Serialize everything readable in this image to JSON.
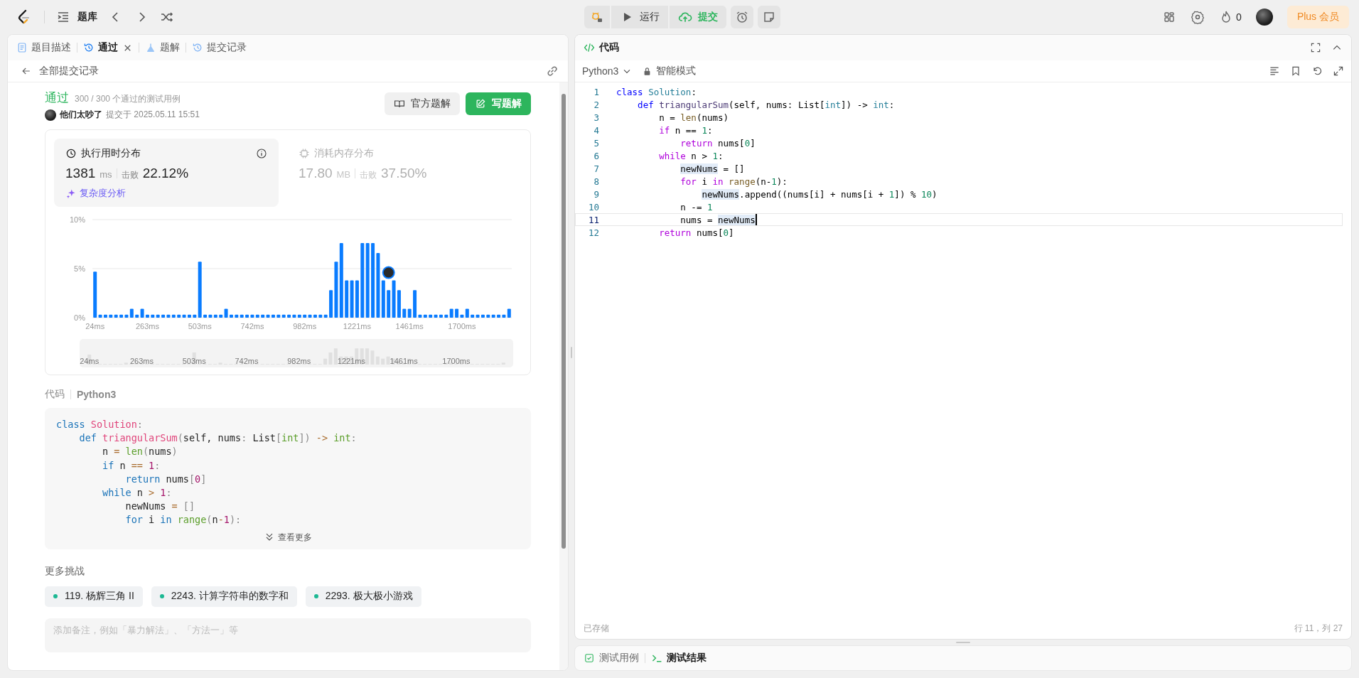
{
  "top_bar": {
    "nav_label": "题库",
    "run_button": "运行",
    "submit_button": "提交",
    "streak_count": "0",
    "plus_button": "Plus 会员"
  },
  "left_panel": {
    "tabs": [
      {
        "label": "题目描述",
        "selected": false,
        "closable": false
      },
      {
        "label": "通过",
        "selected": true,
        "closable": true
      },
      {
        "label": "题解",
        "selected": false,
        "closable": false
      },
      {
        "label": "提交记录",
        "selected": false,
        "closable": false
      }
    ],
    "back_link": "全部提交记录",
    "result": {
      "status": "通过",
      "cases": "300 / 300 个通过的测试用例",
      "user": "他们太吵了",
      "submitted": "提交于 2025.05.11 15:51"
    },
    "buttons": [
      {
        "label": "官方题解",
        "kind": "secondary"
      },
      {
        "label": "写题解",
        "kind": "primary"
      }
    ],
    "metrics": [
      {
        "title": "执行用时分布",
        "value": "1381",
        "unit": "ms",
        "beats_label": "击败",
        "beats": "22.12%",
        "selected": true,
        "link": "复杂度分析"
      },
      {
        "title": "消耗内存分布",
        "value": "17.80",
        "unit": "MB",
        "beats_label": "击败",
        "beats": "37.50%",
        "selected": false
      }
    ],
    "chart_data": {
      "type": "bar",
      "ylim": [
        0,
        10
      ],
      "yticks": [
        {
          "value": 0,
          "label": "0%"
        },
        {
          "value": 5,
          "label": "5%"
        },
        {
          "value": 10,
          "label": "10%"
        }
      ],
      "categories": [
        "24ms",
        null,
        null,
        null,
        null,
        null,
        null,
        null,
        null,
        null,
        "263ms",
        null,
        null,
        null,
        null,
        null,
        null,
        null,
        null,
        null,
        "503ms",
        null,
        null,
        null,
        null,
        null,
        null,
        null,
        null,
        null,
        "742ms",
        null,
        null,
        null,
        null,
        null,
        null,
        null,
        null,
        null,
        "982ms",
        null,
        null,
        null,
        null,
        null,
        null,
        null,
        null,
        null,
        "1221ms",
        null,
        null,
        null,
        null,
        null,
        null,
        null,
        null,
        null,
        "1461ms",
        null,
        null,
        null,
        null,
        null,
        null,
        null,
        null,
        null,
        "1700ms",
        null,
        null,
        null,
        null,
        null,
        null,
        null,
        null,
        null
      ],
      "series": [
        {
          "color": "#0a7cff",
          "values": [
            4.7,
            0.3,
            0.3,
            0.3,
            0.3,
            0.3,
            0.3,
            0.9,
            0.3,
            0.9,
            0.3,
            0.3,
            0.3,
            0.3,
            0.3,
            0.3,
            0.3,
            0.3,
            0.3,
            0.3,
            5.7,
            0.3,
            0.3,
            0.3,
            0.3,
            0.9,
            0.3,
            0.3,
            0.3,
            0.3,
            0.3,
            0.3,
            0.3,
            0.3,
            0.3,
            0.3,
            0.3,
            0.3,
            0.3,
            0.3,
            0.3,
            0.3,
            0.3,
            0.3,
            0.3,
            2.8,
            5.7,
            7.6,
            3.8,
            3.8,
            3.8,
            7.6,
            7.6,
            7.6,
            6.6,
            3.8,
            2.8,
            3.8,
            2.8,
            0.9,
            0.9,
            2.8,
            0.3,
            0.3,
            0.3,
            0.3,
            0.3,
            0.3,
            0.9,
            0.9,
            0.3,
            0.9,
            0.3,
            0.3,
            0.3,
            0.3,
            0.3,
            0.3,
            0.3,
            0.9
          ]
        }
      ]
    },
    "overview": {
      "tick_labels": [
        "24ms",
        "263ms",
        "503ms",
        "742ms",
        "982ms",
        "1221ms",
        "1461ms",
        "1700ms"
      ]
    },
    "code_label": "代码",
    "language": "Python3",
    "code": [
      {
        "tokens": [
          {
            "text": "class",
            "kind": "decl"
          },
          {
            "text": " Solution",
            "kind": "cls"
          },
          {
            "text": ":",
            "kind": "punct"
          }
        ]
      },
      {
        "tokens": [
          {
            "text": "    def",
            "kind": "decl"
          },
          {
            "text": " triangularSum",
            "kind": "fn"
          },
          {
            "text": "(",
            "kind": "punct"
          },
          {
            "text": "self, nums",
            "kind": "plain"
          },
          {
            "text": ":",
            "kind": "punct"
          },
          {
            "text": " List",
            "kind": "plain"
          },
          {
            "text": "[",
            "kind": "punct"
          },
          {
            "text": "int",
            "kind": "type"
          },
          {
            "text": "])",
            "kind": "punct"
          },
          {
            "text": " ->",
            "kind": "op"
          },
          {
            "text": " int",
            "kind": "type"
          },
          {
            "text": ":",
            "kind": "punct"
          }
        ]
      },
      {
        "tokens": [
          {
            "text": "        n",
            "kind": "plain"
          },
          {
            "text": " =",
            "kind": "op"
          },
          {
            "text": " len",
            "kind": "builtin"
          },
          {
            "text": "(",
            "kind": "punct"
          },
          {
            "text": "nums",
            "kind": "plain"
          },
          {
            "text": ")",
            "kind": "punct"
          }
        ]
      },
      {
        "tokens": [
          {
            "text": "        if",
            "kind": "decl"
          },
          {
            "text": " n",
            "kind": "plain"
          },
          {
            "text": " ==",
            "kind": "op"
          },
          {
            "text": " 1",
            "kind": "num"
          },
          {
            "text": ":",
            "kind": "punct"
          }
        ]
      },
      {
        "tokens": [
          {
            "text": "            return",
            "kind": "decl"
          },
          {
            "text": " nums",
            "kind": "plain"
          },
          {
            "text": "[",
            "kind": "punct"
          },
          {
            "text": "0",
            "kind": "num"
          },
          {
            "text": "]",
            "kind": "punct"
          }
        ]
      },
      {
        "tokens": [
          {
            "text": "        while",
            "kind": "decl"
          },
          {
            "text": " n",
            "kind": "plain"
          },
          {
            "text": " >",
            "kind": "op"
          },
          {
            "text": " 1",
            "kind": "num"
          },
          {
            "text": ":",
            "kind": "punct"
          }
        ]
      },
      {
        "tokens": [
          {
            "text": "            newNums",
            "kind": "plain"
          },
          {
            "text": " =",
            "kind": "op"
          },
          {
            "text": " []",
            "kind": "punct"
          }
        ]
      },
      {
        "tokens": [
          {
            "text": "            for",
            "kind": "decl"
          },
          {
            "text": " i",
            "kind": "plain"
          },
          {
            "text": " in",
            "kind": "decl"
          },
          {
            "text": " range",
            "kind": "builtin"
          },
          {
            "text": "(",
            "kind": "punct"
          },
          {
            "text": "n",
            "kind": "plain"
          },
          {
            "text": "-",
            "kind": "op"
          },
          {
            "text": "1",
            "kind": "num"
          },
          {
            "text": "):",
            "kind": "punct"
          }
        ]
      }
    ],
    "more_button": "查看更多",
    "more_title": "更多挑战",
    "challenges": [
      {
        "label": "119. 杨辉三角 II",
        "color": "#1cb893"
      },
      {
        "label": "2243. 计算字符串的数字和",
        "color": "#1cb893"
      },
      {
        "label": "2293. 极大极小游戏",
        "color": "#1cb893"
      }
    ],
    "note": {
      "placeholder": "添加备注，例如「暴力解法」、「方法一」等"
    }
  },
  "editor": {
    "title": "代码",
    "language": "Python3",
    "mode": "智能模式",
    "lines": [
      {
        "number": "1",
        "current": false,
        "tokens": [
          {
            "text": "class",
            "kind": "decl"
          },
          {
            "text": " Solution",
            "kind": "cls"
          },
          {
            "text": ":",
            "kind": "plain"
          }
        ]
      },
      {
        "number": "2",
        "current": false,
        "tokens": [
          {
            "text": "    def",
            "kind": "decl"
          },
          {
            "text": " triangularSum",
            "kind": "fn"
          },
          {
            "text": "(self, nums: List[",
            "kind": "plain"
          },
          {
            "text": "int",
            "kind": "type"
          },
          {
            "text": "]) -> ",
            "kind": "plain"
          },
          {
            "text": "int",
            "kind": "type"
          },
          {
            "text": ":",
            "kind": "plain"
          }
        ]
      },
      {
        "number": "3",
        "current": false,
        "tokens": [
          {
            "text": "        n = ",
            "kind": "plain"
          },
          {
            "text": "len",
            "kind": "builtin"
          },
          {
            "text": "(nums)",
            "kind": "plain"
          }
        ]
      },
      {
        "number": "4",
        "current": false,
        "tokens": [
          {
            "text": "        if",
            "kind": "ctl"
          },
          {
            "text": " n == ",
            "kind": "plain"
          },
          {
            "text": "1",
            "kind": "num"
          },
          {
            "text": ":",
            "kind": "plain"
          }
        ]
      },
      {
        "number": "5",
        "current": false,
        "tokens": [
          {
            "text": "            return",
            "kind": "ctl"
          },
          {
            "text": " nums[",
            "kind": "plain"
          },
          {
            "text": "0",
            "kind": "num"
          },
          {
            "text": "]",
            "kind": "plain"
          }
        ]
      },
      {
        "number": "6",
        "current": false,
        "tokens": [
          {
            "text": "        while",
            "kind": "ctl"
          },
          {
            "text": " n > ",
            "kind": "plain"
          },
          {
            "text": "1",
            "kind": "num"
          },
          {
            "text": ":",
            "kind": "plain"
          }
        ]
      },
      {
        "number": "7",
        "current": false,
        "tokens": [
          {
            "text": "            newNums",
            "kind": "match"
          },
          {
            "text": " = []",
            "kind": "plain"
          }
        ]
      },
      {
        "number": "8",
        "current": false,
        "tokens": [
          {
            "text": "            for",
            "kind": "ctl"
          },
          {
            "text": " i",
            "kind": "plain"
          },
          {
            "text": " in",
            "kind": "ctl"
          },
          {
            "text": " range",
            "kind": "builtin"
          },
          {
            "text": "(n-",
            "kind": "plain"
          },
          {
            "text": "1",
            "kind": "num"
          },
          {
            "text": "):",
            "kind": "plain"
          }
        ]
      },
      {
        "number": "9",
        "current": false,
        "tokens": [
          {
            "text": "                newNums",
            "kind": "match"
          },
          {
            "text": ".append((nums[i] + nums[i + ",
            "kind": "plain"
          },
          {
            "text": "1",
            "kind": "num"
          },
          {
            "text": "]) % ",
            "kind": "plain"
          },
          {
            "text": "10",
            "kind": "num"
          },
          {
            "text": ")",
            "kind": "plain"
          }
        ]
      },
      {
        "number": "10",
        "current": false,
        "tokens": [
          {
            "text": "            n -= ",
            "kind": "plain"
          },
          {
            "text": "1",
            "kind": "num"
          }
        ]
      },
      {
        "number": "11",
        "current": true,
        "tokens": [
          {
            "text": "            nums = ",
            "kind": "plain"
          },
          {
            "text": "newNums",
            "kind": "match"
          }
        ]
      },
      {
        "number": "12",
        "current": false,
        "tokens": [
          {
            "text": "        return",
            "kind": "ctl"
          },
          {
            "text": " nums[",
            "kind": "plain"
          },
          {
            "text": "0",
            "kind": "num"
          },
          {
            "text": "]",
            "kind": "plain"
          }
        ]
      }
    ],
    "saved": "已存储",
    "cursor": "行 11，列 27"
  },
  "bottom_panel": {
    "tabs": [
      {
        "label": "测试用例",
        "selected": false
      },
      {
        "label": "测试结果",
        "selected": true
      }
    ]
  }
}
